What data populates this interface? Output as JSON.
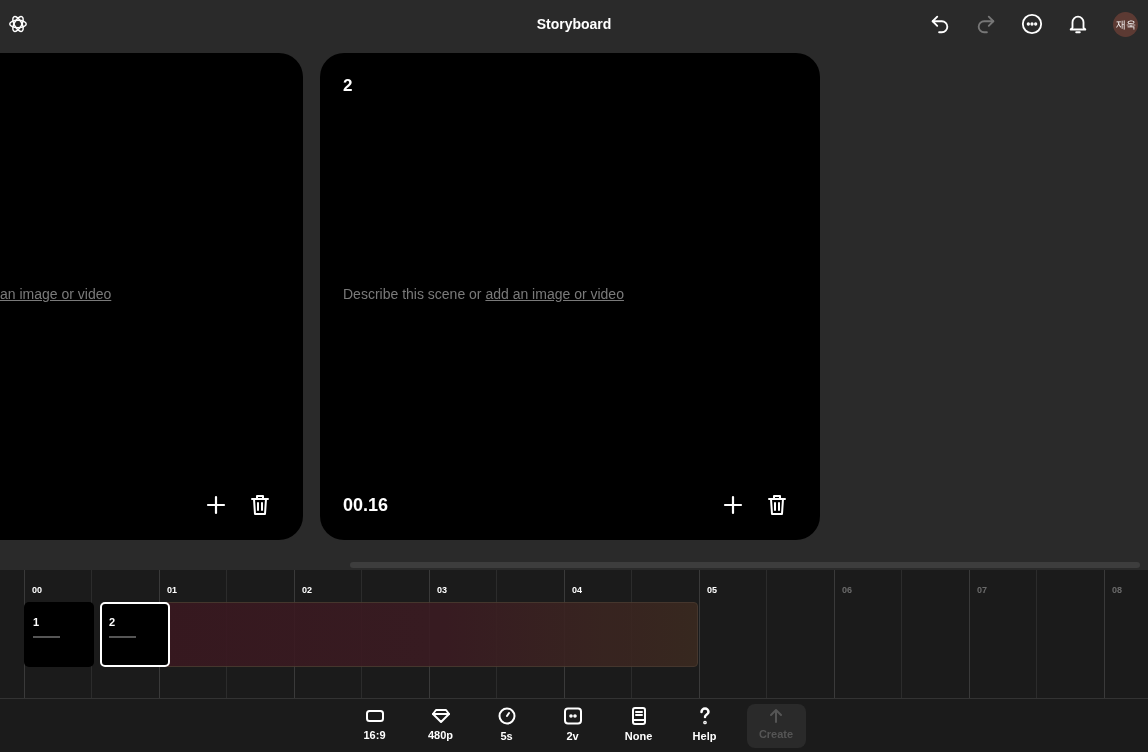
{
  "header": {
    "title": "Storyboard",
    "avatar": "재욱",
    "actions": [
      {
        "kind": "undo",
        "disabled": false
      },
      {
        "kind": "redo",
        "disabled": true
      },
      {
        "kind": "more",
        "disabled": false
      },
      {
        "kind": "bell",
        "disabled": false
      }
    ]
  },
  "scenes": [
    {
      "link": "an image or video",
      "partial": true
    },
    {
      "number": "2",
      "prompt": "Describe this scene or ",
      "link": "add an image or video",
      "time": "00.16",
      "partial": false
    }
  ],
  "timeline": {
    "ruler": [
      {
        "label": "00",
        "dim": false
      },
      {
        "label": "01",
        "dim": false
      },
      {
        "label": "02",
        "dim": false
      },
      {
        "label": "03",
        "dim": false
      },
      {
        "label": "04",
        "dim": false
      },
      {
        "label": "05",
        "dim": false
      },
      {
        "label": "06",
        "dim": true
      },
      {
        "label": "07",
        "dim": true
      },
      {
        "label": "08",
        "dim": true
      }
    ],
    "clips": [
      {
        "label": "1",
        "selected": false
      },
      {
        "label": "2",
        "selected": true
      }
    ]
  },
  "toolbar": [
    {
      "kind": "ratio",
      "label": "16:9"
    },
    {
      "kind": "quality",
      "label": "480p"
    },
    {
      "kind": "duration",
      "label": "5s"
    },
    {
      "kind": "variations",
      "label": "2v"
    },
    {
      "kind": "preset",
      "label": "None"
    },
    {
      "kind": "help",
      "label": "Help"
    }
  ],
  "create": {
    "label": "Create",
    "disabled": true
  }
}
